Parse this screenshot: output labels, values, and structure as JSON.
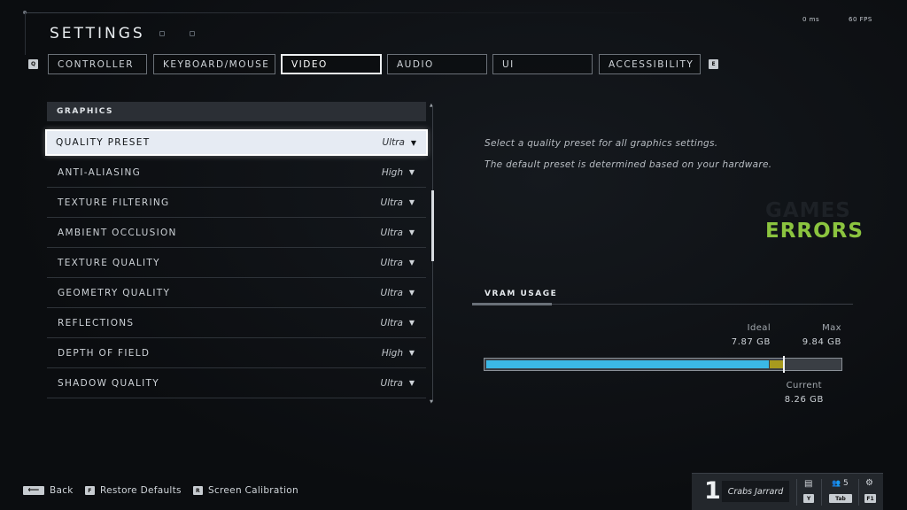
{
  "header": {
    "title": "SETTINGS"
  },
  "perf": {
    "latency": "0 ms",
    "fps": "60 FPS"
  },
  "tabs": {
    "prev_key": "Q",
    "next_key": "E",
    "items": [
      {
        "label": "CONTROLLER"
      },
      {
        "label": "KEYBOARD/MOUSE"
      },
      {
        "label": "VIDEO"
      },
      {
        "label": "AUDIO"
      },
      {
        "label": "UI"
      },
      {
        "label": "ACCESSIBILITY"
      }
    ],
    "active_index": 2
  },
  "graphics": {
    "section_title": "GRAPHICS",
    "rows": [
      {
        "label": "QUALITY PRESET",
        "value": "Ultra"
      },
      {
        "label": "ANTI-ALIASING",
        "value": "High"
      },
      {
        "label": "TEXTURE FILTERING",
        "value": "Ultra"
      },
      {
        "label": "AMBIENT OCCLUSION",
        "value": "Ultra"
      },
      {
        "label": "TEXTURE QUALITY",
        "value": "Ultra"
      },
      {
        "label": "GEOMETRY QUALITY",
        "value": "Ultra"
      },
      {
        "label": "REFLECTIONS",
        "value": "Ultra"
      },
      {
        "label": "DEPTH OF FIELD",
        "value": "High"
      },
      {
        "label": "SHADOW QUALITY",
        "value": "Ultra"
      }
    ],
    "selected_index": 0
  },
  "description": {
    "line1": "Select a quality preset for all graphics settings.",
    "line2": "The default preset is determined based on your hardware."
  },
  "watermark": {
    "line1": "GAMES",
    "line2": "ERRORS"
  },
  "vram": {
    "title": "VRAM USAGE",
    "ideal_label": "Ideal",
    "ideal_value": "7.87 GB",
    "max_label": "Max",
    "max_value": "9.84 GB",
    "current_label": "Current",
    "current_value": "8.26 GB",
    "ideal_gb": 7.87,
    "current_gb": 8.26,
    "max_gb": 9.84
  },
  "footer": {
    "back_label": "Back",
    "restore_key": "F",
    "restore_label": "Restore Defaults",
    "calib_key": "R",
    "calib_label": "Screen Calibration"
  },
  "player": {
    "rank": "1",
    "name": "Crabs Jarrard",
    "chat_key": "Y",
    "party_count": "5",
    "party_key": "Tab",
    "settings_key": "F1"
  },
  "colors": {
    "accent_blue": "#3bb8e6",
    "over_olive": "#a79a1e",
    "watermark_green": "#8bc43f"
  }
}
